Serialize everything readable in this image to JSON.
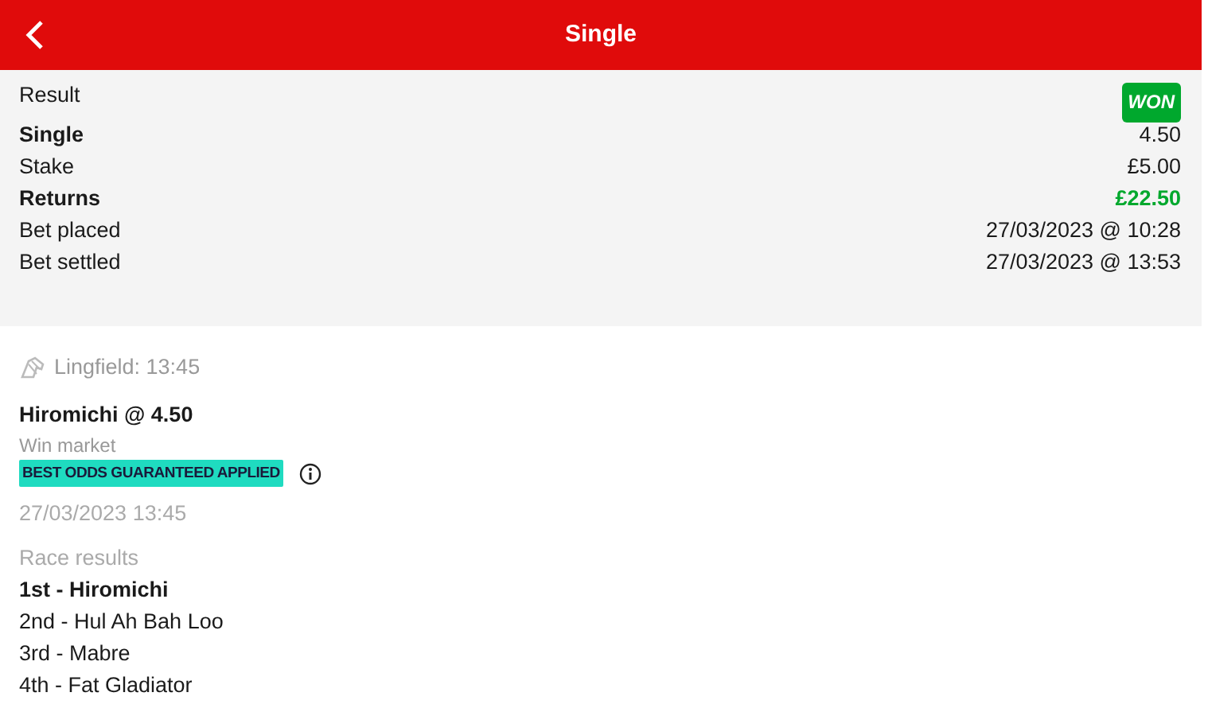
{
  "header": {
    "title": "Single"
  },
  "summary": [
    {
      "label": "Result",
      "value": "WON",
      "kind": "badge",
      "emphasis": false
    },
    {
      "label": "Single",
      "value": "4.50",
      "kind": "plain",
      "emphasis": true
    },
    {
      "label": "Stake",
      "value": "£5.00",
      "kind": "plain",
      "emphasis": false
    },
    {
      "label": "Returns",
      "value": "£22.50",
      "kind": "positive",
      "emphasis": true
    },
    {
      "label": "Bet placed",
      "value": "27/03/2023 @ 10:28",
      "kind": "plain",
      "emphasis": false
    },
    {
      "label": "Bet settled",
      "value": "27/03/2023 @ 13:53",
      "kind": "plain",
      "emphasis": false
    }
  ],
  "event": {
    "name": "Lingfield: 13:45",
    "selection": "Hiromichi @ 4.50",
    "market": "Win market",
    "tag": "BEST ODDS GUARANTEED APPLIED",
    "date": "27/03/2023 13:45"
  },
  "race_results": {
    "heading": "Race results",
    "places": [
      {
        "text": "1st - Hiromichi",
        "winner": true
      },
      {
        "text": "2nd - Hul Ah Bah Loo",
        "winner": false
      },
      {
        "text": "3rd - Mabre",
        "winner": false
      },
      {
        "text": "4th - Fat Gladiator",
        "winner": false
      }
    ]
  }
}
